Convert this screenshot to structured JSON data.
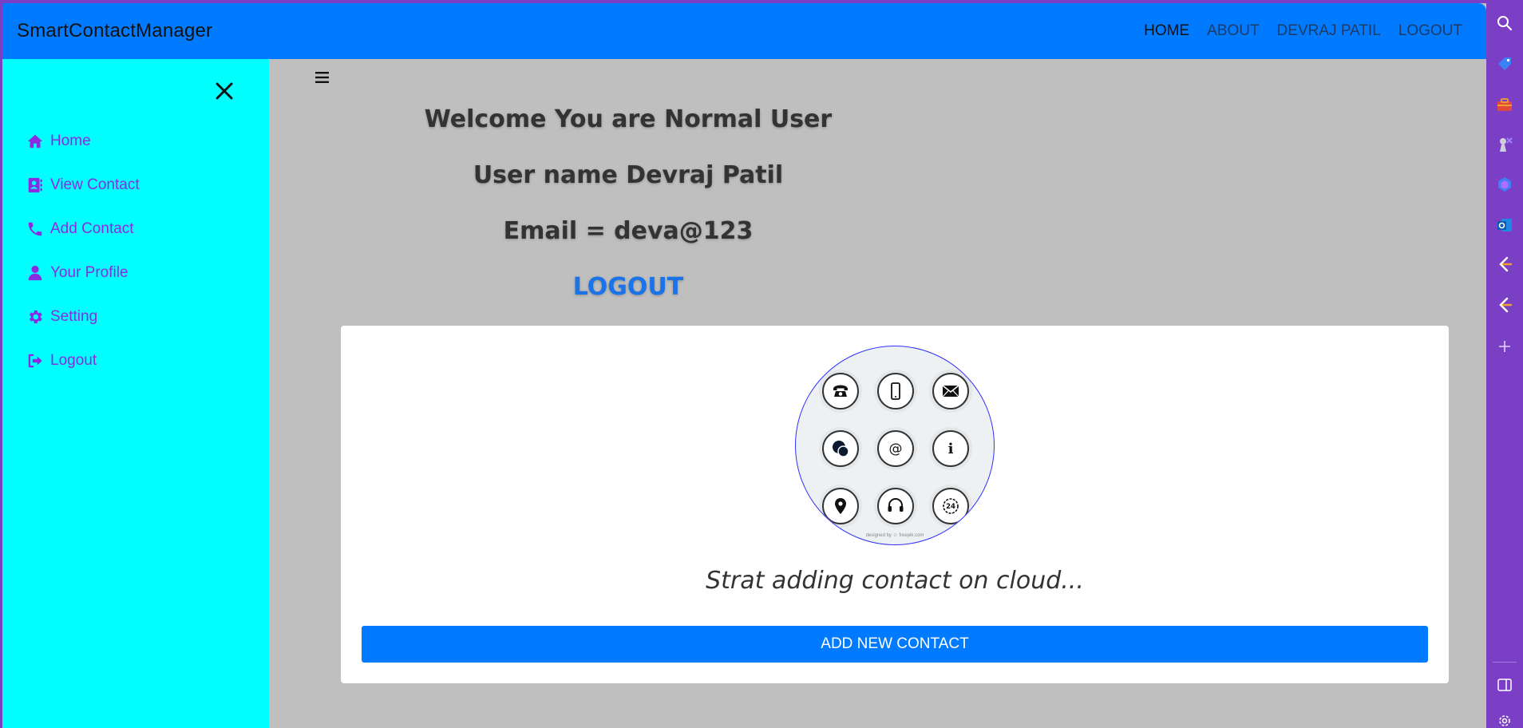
{
  "navbar": {
    "brand": "SmartContactManager",
    "links": [
      "HOME",
      "ABOUT",
      "DEVRAJ PATIL",
      "LOGOUT"
    ]
  },
  "sidebar": {
    "items": [
      {
        "label": "Home",
        "icon": "home-icon"
      },
      {
        "label": "View Contact",
        "icon": "address-book-icon"
      },
      {
        "label": "Add Contact",
        "icon": "phone-icon"
      },
      {
        "label": "Your Profile",
        "icon": "user-icon"
      },
      {
        "label": "Setting",
        "icon": "gear-icon"
      },
      {
        "label": "Logout",
        "icon": "sign-out-icon"
      }
    ]
  },
  "main": {
    "welcome": "Welcome You are Normal User",
    "username": "User name Devraj Patil",
    "email": "Email = deva@123",
    "logout": "LOGOUT"
  },
  "card": {
    "image_credit": "designed by ☺ freepik.com",
    "tagline": "Strat adding contact on cloud...",
    "button": "ADD NEW CONTACT"
  },
  "colors": {
    "navbar": "#007bff",
    "sidebar": "#00ffff",
    "sidebar_text": "#8a2be2",
    "content_bg": "#bfbfbf",
    "button": "#007bff",
    "rail": "#7b3fc6"
  }
}
